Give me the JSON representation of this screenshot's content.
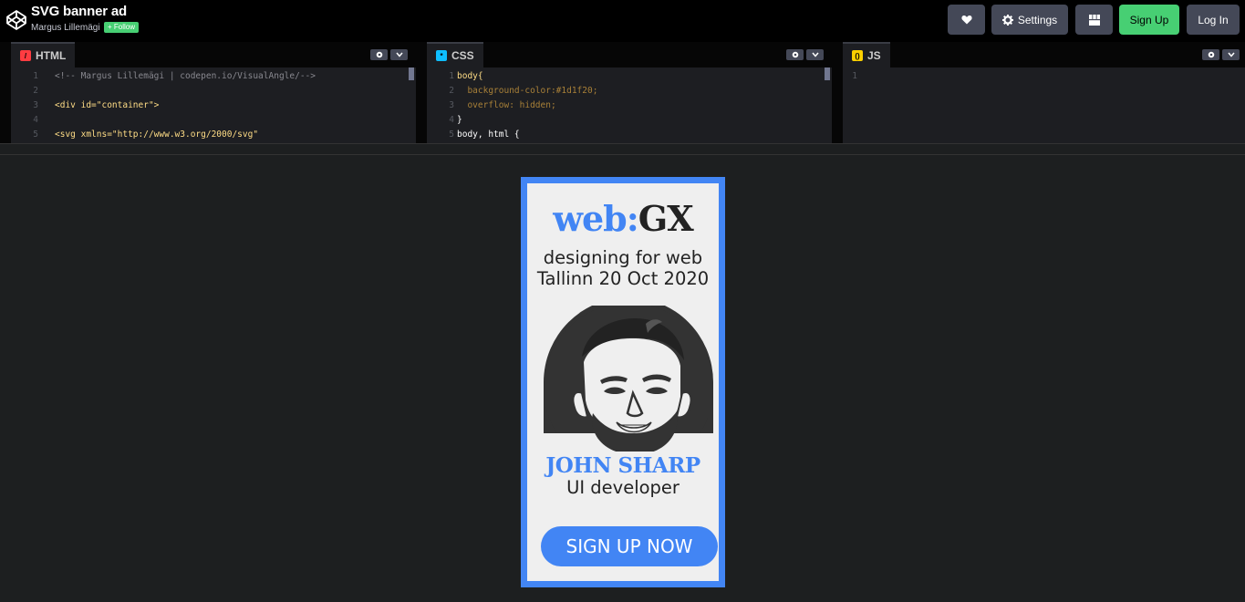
{
  "header": {
    "title": "SVG banner ad",
    "author": "Margus Lillemägi",
    "follow_label": "+ Follow",
    "buttons": {
      "heart": "heart-icon",
      "settings_label": "Settings",
      "layout": "layout-icon",
      "signup_label": "Sign Up",
      "login_label": "Log In"
    }
  },
  "editors": {
    "html": {
      "label": "HTML",
      "lines": [
        {
          "n": "1",
          "text": "<!-- Margus Lillemägi | codepen.io/VisualAngle/-->"
        },
        {
          "n": "2",
          "text": ""
        },
        {
          "n": "3",
          "text": "<div id=\"container\">"
        },
        {
          "n": "4",
          "text": ""
        },
        {
          "n": "5",
          "text": "<svg xmlns=\"http://www.w3.org/2000/svg\""
        }
      ]
    },
    "css": {
      "label": "CSS",
      "lines": [
        {
          "n": "1",
          "text": "body{"
        },
        {
          "n": "2",
          "text": "  background-color:#1d1f20;"
        },
        {
          "n": "3",
          "text": "  overflow: hidden;"
        },
        {
          "n": "4",
          "text": "}"
        },
        {
          "n": "5",
          "text": "body, html {"
        }
      ]
    },
    "js": {
      "label": "JS",
      "lines": [
        {
          "n": "1",
          "text": ""
        }
      ]
    }
  },
  "banner": {
    "brand_part1": "web:",
    "brand_part2": "GX",
    "tagline_line1": "designing for web",
    "tagline_line2": "Tallinn 20 Oct 2020",
    "person_name": "JOHN SHARP",
    "person_role": "UI developer",
    "cta_label": "SIGN UP NOW",
    "colors": {
      "accent": "#4285f4",
      "card": "#efefef",
      "dark": "#333333"
    }
  }
}
